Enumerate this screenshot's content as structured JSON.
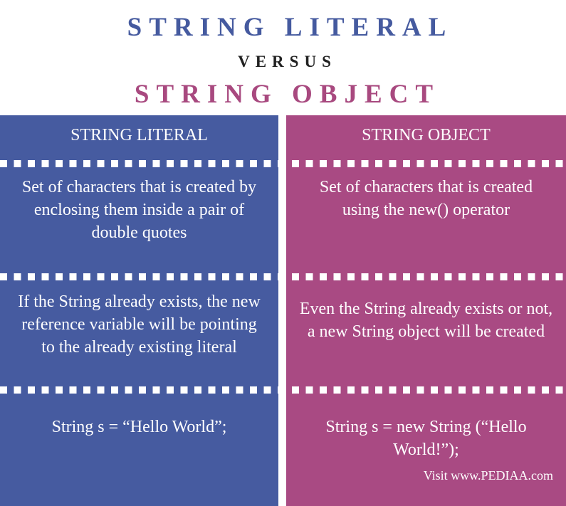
{
  "title": {
    "line1": "STRING LITERAL",
    "versus": "VERSUS",
    "line2": "STRING OBJECT"
  },
  "colors": {
    "literal_accent": "#465ba0",
    "object_accent": "#a94a83",
    "versus_text": "#222222",
    "panel_text": "#ffffff"
  },
  "columns": [
    {
      "heading": "STRING LITERAL",
      "rows": [
        "Set of characters that is created by enclosing them inside a pair of double quotes",
        "If the String already exists, the new reference variable will be pointing to the already existing literal",
        "String s = “Hello World”;"
      ]
    },
    {
      "heading": "STRING OBJECT",
      "rows": [
        "Set of characters that is created using the new() operator",
        "Even the String already exists or not, a new String object will be created",
        "String s = new String (“Hello World!”);"
      ]
    }
  ],
  "footer": {
    "credit": "Visit www.PEDIAA.com"
  }
}
